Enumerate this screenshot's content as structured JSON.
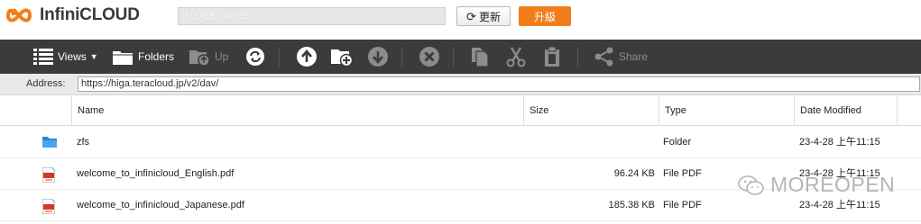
{
  "app": {
    "logo_text": "InfiniCLOUD",
    "quota_text": "0.00GB / 45GB",
    "refresh_label": "更新",
    "upgrade_label": "升級",
    "brand_color": "#f07e1a"
  },
  "toolbar": {
    "views_label": "Views",
    "folders_label": "Folders",
    "up_label": "Up",
    "share_label": "Share"
  },
  "address": {
    "label": "Address:",
    "value": "https://higa.teracloud.jp/v2/dav/"
  },
  "table": {
    "columns": [
      "Name",
      "Size",
      "Type",
      "Date Modified"
    ],
    "rows": [
      {
        "icon": "folder-icon",
        "name": "zfs",
        "size": "",
        "type": "Folder",
        "date": "23-4-28 上午11:15"
      },
      {
        "icon": "pdf-icon",
        "name": "welcome_to_infinicloud_English.pdf",
        "size": "96.24 KB",
        "type": "File PDF",
        "date": "23-4-28 上午11:15"
      },
      {
        "icon": "pdf-icon",
        "name": "welcome_to_infinicloud_Japanese.pdf",
        "size": "185.38 KB",
        "type": "File PDF",
        "date": "23-4-28 上午11:15"
      }
    ]
  },
  "watermark": "MOREOPEN"
}
